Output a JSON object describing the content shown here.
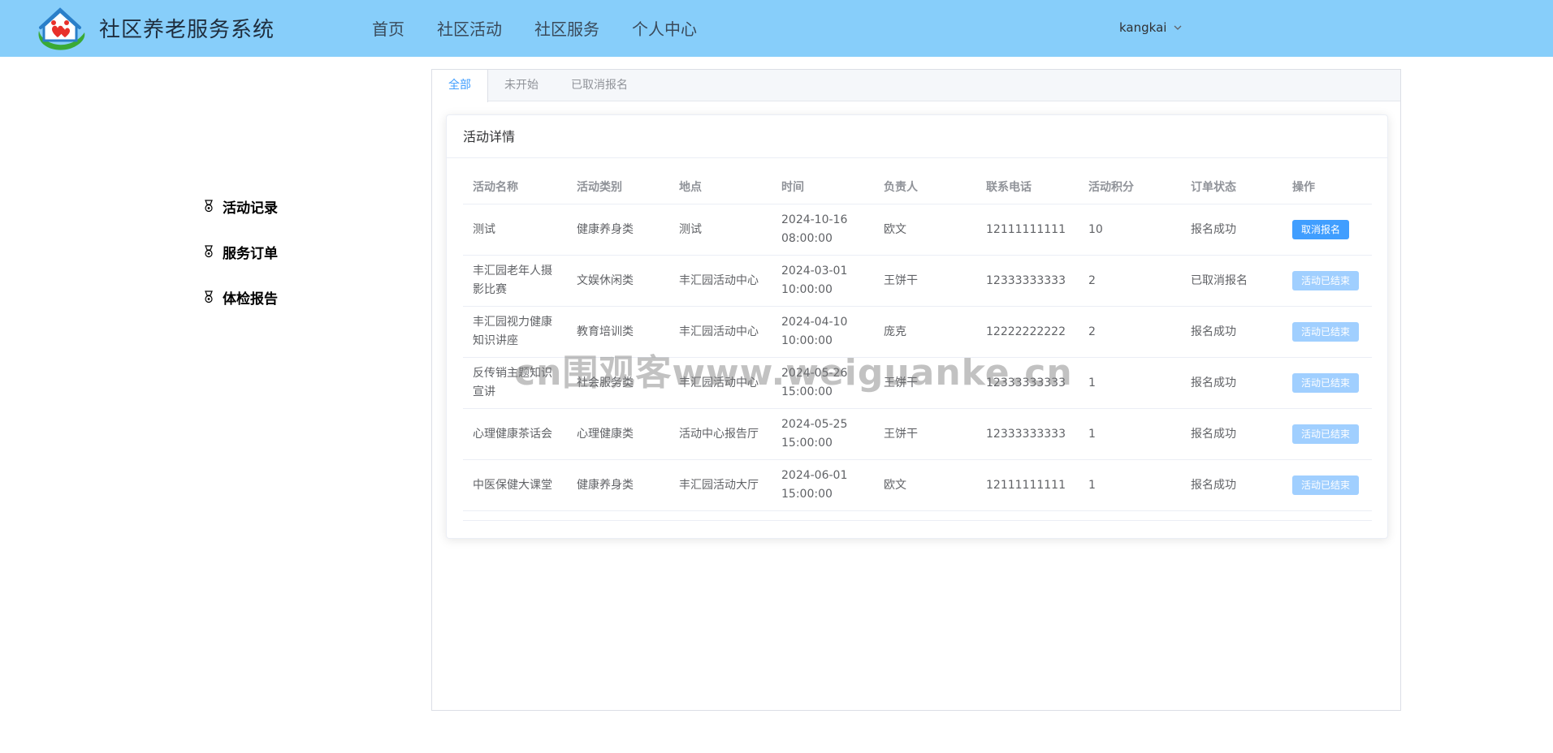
{
  "header": {
    "title": "社区养老服务系统",
    "nav": [
      "首页",
      "社区活动",
      "社区服务",
      "个人中心"
    ],
    "user": "kangkai"
  },
  "sidebar": {
    "items": [
      {
        "label": "活动记录",
        "icon": "medal-icon"
      },
      {
        "label": "服务订单",
        "icon": "medal-icon"
      },
      {
        "label": "体检报告",
        "icon": "medal-icon"
      }
    ]
  },
  "tabs": [
    "全部",
    "未开始",
    "已取消报名"
  ],
  "active_tab": "全部",
  "card": {
    "title": "活动详情",
    "columns": [
      "活动名称",
      "活动类别",
      "地点",
      "时间",
      "负责人",
      "联系电话",
      "活动积分",
      "订单状态",
      "操作"
    ],
    "rows": [
      {
        "name": "测试",
        "category": "健康养身类",
        "location": "测试",
        "date": "2024-10-16",
        "time": "08:00:00",
        "person": "欧文",
        "phone": "12111111111",
        "points": "10",
        "status": "报名成功",
        "action": "取消报名",
        "action_enabled": true
      },
      {
        "name": "丰汇园老年人摄影比赛",
        "category": "文娱休闲类",
        "location": "丰汇园活动中心",
        "date": "2024-03-01",
        "time": "10:00:00",
        "person": "王饼干",
        "phone": "12333333333",
        "points": "2",
        "status": "已取消报名",
        "action": "活动已结束",
        "action_enabled": false
      },
      {
        "name": "丰汇园视力健康知识讲座",
        "category": "教育培训类",
        "location": "丰汇园活动中心",
        "date": "2024-04-10",
        "time": "10:00:00",
        "person": "庞克",
        "phone": "12222222222",
        "points": "2",
        "status": "报名成功",
        "action": "活动已结束",
        "action_enabled": false
      },
      {
        "name": "反传销主题知识宣讲",
        "category": "社会服务类",
        "location": "丰汇园活动中心",
        "date": "2024-05-26",
        "time": "15:00:00",
        "person": "王饼干",
        "phone": "12333333333",
        "points": "1",
        "status": "报名成功",
        "action": "活动已结束",
        "action_enabled": false
      },
      {
        "name": "心理健康茶话会",
        "category": "心理健康类",
        "location": "活动中心报告厅",
        "date": "2024-05-25",
        "time": "15:00:00",
        "person": "王饼干",
        "phone": "12333333333",
        "points": "1",
        "status": "报名成功",
        "action": "活动已结束",
        "action_enabled": false
      },
      {
        "name": "中医保健大课堂",
        "category": "健康养身类",
        "location": "丰汇园活动大厅",
        "date": "2024-06-01",
        "time": "15:00:00",
        "person": "欧文",
        "phone": "12111111111",
        "points": "1",
        "status": "报名成功",
        "action": "活动已结束",
        "action_enabled": false
      }
    ]
  },
  "watermark": "cn围观客www.weiguanke.cn",
  "colors": {
    "header_bg": "#87cefa",
    "primary": "#409eff",
    "disabled": "#a0cfff"
  }
}
